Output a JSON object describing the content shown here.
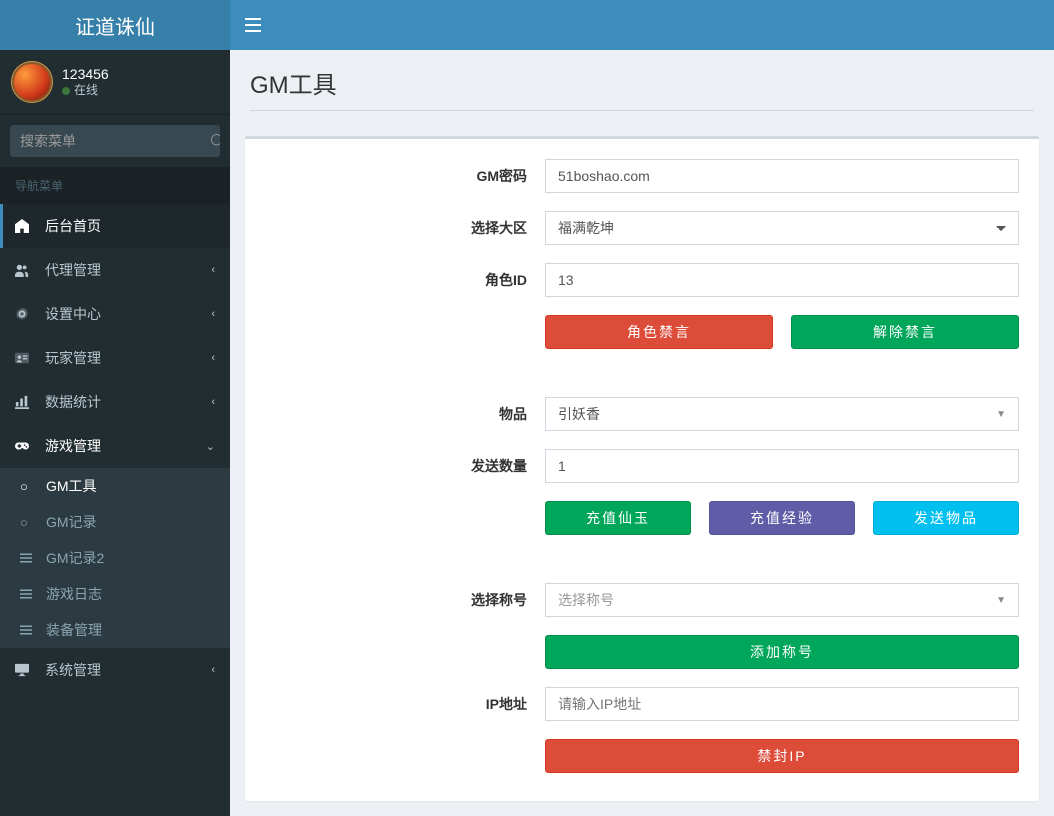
{
  "brand": "证道诛仙",
  "user": {
    "name": "123456",
    "status": "在线"
  },
  "search": {
    "placeholder": "搜索菜单"
  },
  "nav_header": "导航菜单",
  "nav": {
    "home": "后台首页",
    "agent": "代理管理",
    "settings": "设置中心",
    "players": "玩家管理",
    "stats": "数据统计",
    "game": "游戏管理",
    "system": "系统管理"
  },
  "game_sub": {
    "gm_tool": "GM工具",
    "gm_record": "GM记录",
    "gm_record2": "GM记录2",
    "game_log": "游戏日志",
    "equip": "装备管理"
  },
  "page": {
    "title": "GM工具"
  },
  "form": {
    "labels": {
      "gm_password": "GM密码",
      "region": "选择大区",
      "role_id": "角色ID",
      "item": "物品",
      "send_qty": "发送数量",
      "title_select": "选择称号",
      "ip": "IP地址"
    },
    "values": {
      "gm_password": "51boshao.com",
      "region_selected": "福满乾坤",
      "role_id": "13",
      "item_selected": "引妖香",
      "send_qty": "1",
      "title_placeholder": "选择称号",
      "ip_placeholder": "请输入IP地址"
    },
    "buttons": {
      "ban_speak": "角色禁言",
      "unban_speak": "解除禁言",
      "recharge_jade": "充值仙玉",
      "recharge_exp": "充值经验",
      "send_item": "发送物品",
      "add_title": "添加称号",
      "ban_ip": "禁封IP"
    }
  }
}
